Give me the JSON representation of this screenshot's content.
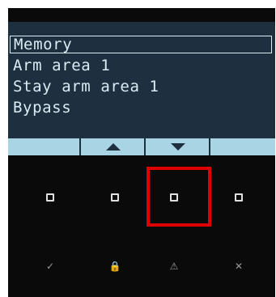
{
  "menu": {
    "items": [
      {
        "label": "Memory",
        "selected": true
      },
      {
        "label": "Arm area 1",
        "selected": false
      },
      {
        "label": "Stay arm area 1",
        "selected": false
      },
      {
        "label": "Bypass",
        "selected": false
      }
    ]
  },
  "softkeys": [
    {
      "icon": ""
    },
    {
      "icon": "up-arrow-icon"
    },
    {
      "icon": "down-arrow-icon"
    },
    {
      "icon": ""
    }
  ],
  "bottom_icons": [
    {
      "icon": "check-icon",
      "glyph": "✓"
    },
    {
      "icon": "lock-icon",
      "glyph": "🔒"
    },
    {
      "icon": "warning-icon",
      "glyph": "⚠"
    },
    {
      "icon": "close-icon",
      "glyph": "✕"
    }
  ],
  "colors": {
    "screen_bg": "#1e2f3f",
    "screen_text": "#d8ecf4",
    "softkey_bar": "#a8d4e4",
    "device_bg": "#0a0a0a",
    "highlight": "#e00000"
  }
}
